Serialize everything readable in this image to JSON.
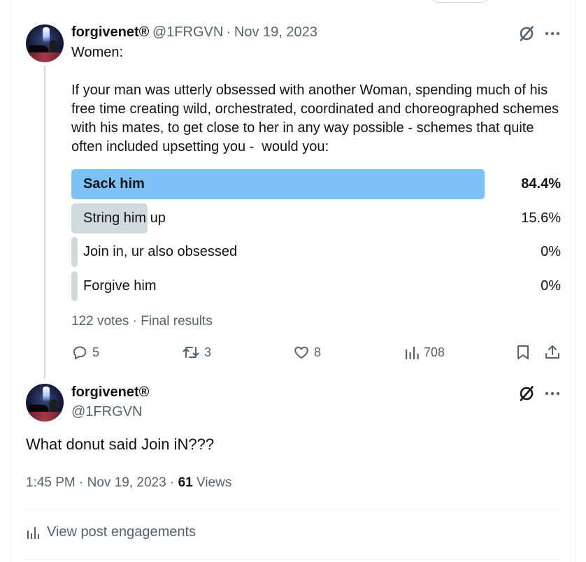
{
  "original_tweet": {
    "author_name": "forgivenet®",
    "handle": "@1FRGVN",
    "separator": "·",
    "date": "Nov 19, 2023",
    "text": "Women:\n\nIf your man was utterly obsessed with another Woman, spending much of his free time creating wild, orchestrated, coordinated and choreographed schemes with his mates, to get close to her in any way possible - schemes that quite often included upsetting you -  would you:",
    "poll": {
      "options": [
        {
          "label": "Sack him",
          "percent_text": "84.4%",
          "percent": 84.4,
          "winner": true
        },
        {
          "label": "String him up",
          "percent_text": "15.6%",
          "percent": 15.6,
          "winner": false
        },
        {
          "label": "Join in, ur also obsessed",
          "percent_text": "0%",
          "percent": 0,
          "winner": false
        },
        {
          "label": "Forgive him",
          "percent_text": "0%",
          "percent": 0,
          "winner": false
        }
      ],
      "meta": "122 votes · Final results"
    },
    "actions": {
      "replies": "5",
      "reposts": "3",
      "likes": "8",
      "views": "708"
    }
  },
  "reply_tweet": {
    "author_name": "forgivenet®",
    "handle": "@1FRGVN",
    "text": "What donut said Join iN???",
    "time": "1:45 PM",
    "date": "Nov 19, 2023",
    "views_count": "61",
    "views_label": "Views",
    "engagements_label": "View post engagements"
  },
  "colors": {
    "winner_fill": "#7cc3f5",
    "loser_fill": "#cfd9de",
    "muted_text": "#536471",
    "primary_text": "#0f1419"
  }
}
